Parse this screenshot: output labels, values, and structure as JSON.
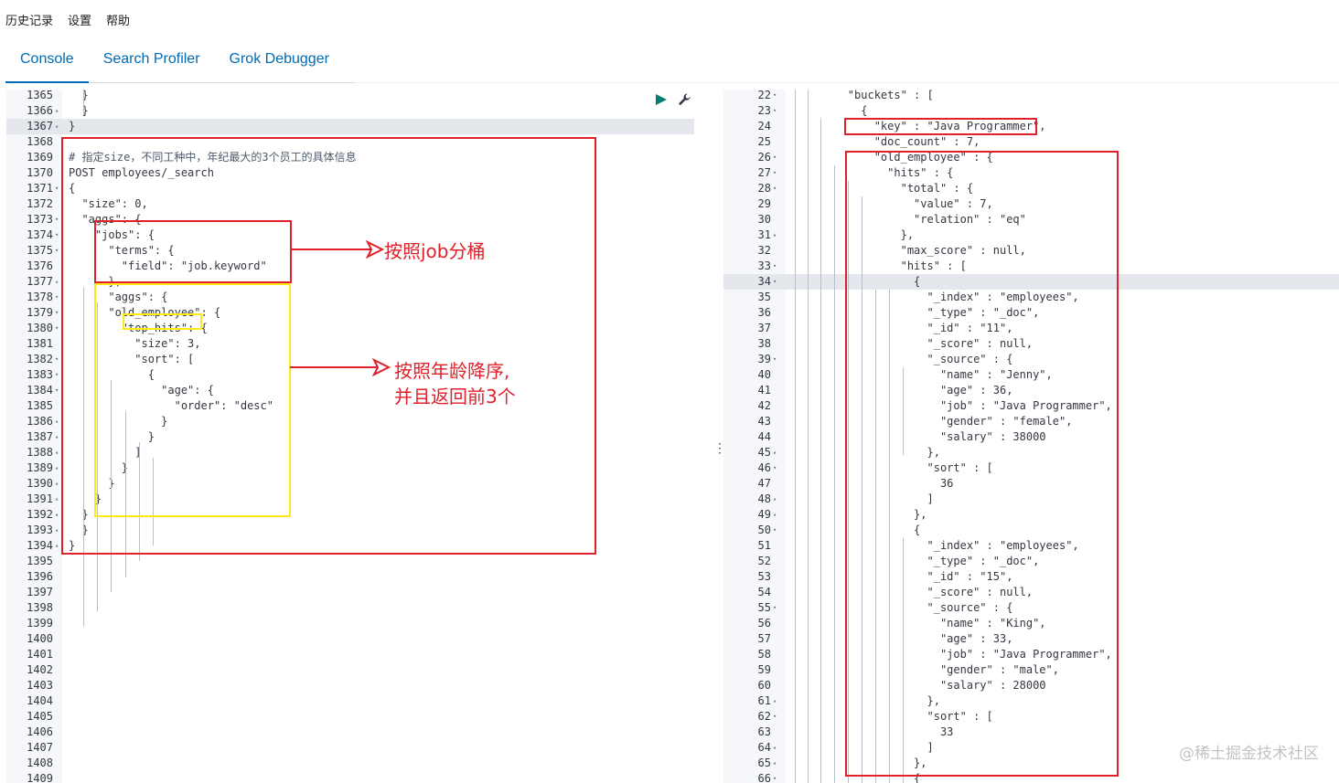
{
  "top_menu": [
    "历史记录",
    "设置",
    "帮助"
  ],
  "tabs": [
    "Console",
    "Search Profiler",
    "Grok Debugger"
  ],
  "active_tab": "Console",
  "annotations": {
    "terms_note": "按照job分桶",
    "top_hits_note_1": "按照年龄降序,",
    "top_hits_note_2": "并且返回前3个"
  },
  "watermark": "@稀土掘金技术社区",
  "icons": {
    "run": "play-icon",
    "settings": "wrench-icon",
    "splitter": "vertical-dots-icon"
  },
  "colors": {
    "accent": "#006bb4",
    "annotation_red": "#e0202a",
    "annotation_yellow": "#ffe81a"
  },
  "editor": {
    "lines": [
      {
        "no": "1365",
        "fold": "",
        "text": "  }"
      },
      {
        "no": "1366",
        "fold": "▴",
        "text": "  }"
      },
      {
        "no": "1367",
        "fold": "▴",
        "text": "}"
      },
      {
        "no": "1368",
        "fold": "",
        "text": ""
      },
      {
        "no": "1369",
        "fold": "",
        "text": "# 指定size，不同工种中，年纪最大的3个员工的具体信息"
      },
      {
        "no": "1370",
        "fold": "",
        "text": "POST employees/_search"
      },
      {
        "no": "1371",
        "fold": "▾",
        "text": "{"
      },
      {
        "no": "1372",
        "fold": "",
        "text": "  \"size\": 0,"
      },
      {
        "no": "1373",
        "fold": "▾",
        "text": "  \"aggs\": {"
      },
      {
        "no": "1374",
        "fold": "▾",
        "text": "    \"jobs\": {"
      },
      {
        "no": "1375",
        "fold": "▾",
        "text": "      \"terms\": {"
      },
      {
        "no": "1376",
        "fold": "",
        "text": "        \"field\": \"job.keyword\""
      },
      {
        "no": "1377",
        "fold": "▴",
        "text": "      },"
      },
      {
        "no": "1378",
        "fold": "▾",
        "text": "      \"aggs\": {"
      },
      {
        "no": "1379",
        "fold": "▾",
        "text": "      \"old_employee\": {"
      },
      {
        "no": "1380",
        "fold": "▾",
        "text": "        \"top_hits\": {"
      },
      {
        "no": "1381",
        "fold": "",
        "text": "          \"size\": 3,"
      },
      {
        "no": "1382",
        "fold": "▾",
        "text": "          \"sort\": ["
      },
      {
        "no": "1383",
        "fold": "▾",
        "text": "            {"
      },
      {
        "no": "1384",
        "fold": "▾",
        "text": "              \"age\": {"
      },
      {
        "no": "1385",
        "fold": "",
        "text": "                \"order\": \"desc\""
      },
      {
        "no": "1386",
        "fold": "▴",
        "text": "              }"
      },
      {
        "no": "1387",
        "fold": "▴",
        "text": "            }"
      },
      {
        "no": "1388",
        "fold": "▴",
        "text": "          ]"
      },
      {
        "no": "1389",
        "fold": "▴",
        "text": "        }"
      },
      {
        "no": "1390",
        "fold": "▴",
        "text": "      }"
      },
      {
        "no": "1391",
        "fold": "▴",
        "text": "    }"
      },
      {
        "no": "1392",
        "fold": "▴",
        "text": "  }"
      },
      {
        "no": "1393",
        "fold": "▴",
        "text": "  }"
      },
      {
        "no": "1394",
        "fold": "▴",
        "text": "}"
      },
      {
        "no": "1395",
        "fold": "",
        "text": ""
      },
      {
        "no": "1396",
        "fold": "",
        "text": ""
      },
      {
        "no": "1397",
        "fold": "",
        "text": ""
      },
      {
        "no": "1398",
        "fold": "",
        "text": ""
      },
      {
        "no": "1399",
        "fold": "",
        "text": ""
      },
      {
        "no": "1400",
        "fold": "",
        "text": ""
      },
      {
        "no": "1401",
        "fold": "",
        "text": ""
      },
      {
        "no": "1402",
        "fold": "",
        "text": ""
      },
      {
        "no": "1403",
        "fold": "",
        "text": ""
      },
      {
        "no": "1404",
        "fold": "",
        "text": ""
      },
      {
        "no": "1405",
        "fold": "",
        "text": ""
      },
      {
        "no": "1406",
        "fold": "",
        "text": ""
      },
      {
        "no": "1407",
        "fold": "",
        "text": ""
      },
      {
        "no": "1408",
        "fold": "",
        "text": ""
      },
      {
        "no": "1409",
        "fold": "",
        "text": ""
      }
    ]
  },
  "output": {
    "lines": [
      {
        "no": "22",
        "fold": "▾",
        "text": "        \"buckets\" : ["
      },
      {
        "no": "23",
        "fold": "▾",
        "text": "          {"
      },
      {
        "no": "24",
        "fold": "",
        "text": "            \"key\" : \"Java Programmer\","
      },
      {
        "no": "25",
        "fold": "",
        "text": "            \"doc_count\" : 7,"
      },
      {
        "no": "26",
        "fold": "▾",
        "text": "            \"old_employee\" : {"
      },
      {
        "no": "27",
        "fold": "▾",
        "text": "              \"hits\" : {"
      },
      {
        "no": "28",
        "fold": "▾",
        "text": "                \"total\" : {"
      },
      {
        "no": "29",
        "fold": "",
        "text": "                  \"value\" : 7,"
      },
      {
        "no": "30",
        "fold": "",
        "text": "                  \"relation\" : \"eq\""
      },
      {
        "no": "31",
        "fold": "▴",
        "text": "                },"
      },
      {
        "no": "32",
        "fold": "",
        "text": "                \"max_score\" : null,"
      },
      {
        "no": "33",
        "fold": "▾",
        "text": "                \"hits\" : ["
      },
      {
        "no": "34",
        "fold": "▾",
        "text": "                  {"
      },
      {
        "no": "35",
        "fold": "",
        "text": "                    \"_index\" : \"employees\","
      },
      {
        "no": "36",
        "fold": "",
        "text": "                    \"_type\" : \"_doc\","
      },
      {
        "no": "37",
        "fold": "",
        "text": "                    \"_id\" : \"11\","
      },
      {
        "no": "38",
        "fold": "",
        "text": "                    \"_score\" : null,"
      },
      {
        "no": "39",
        "fold": "▾",
        "text": "                    \"_source\" : {"
      },
      {
        "no": "40",
        "fold": "",
        "text": "                      \"name\" : \"Jenny\","
      },
      {
        "no": "41",
        "fold": "",
        "text": "                      \"age\" : 36,"
      },
      {
        "no": "42",
        "fold": "",
        "text": "                      \"job\" : \"Java Programmer\","
      },
      {
        "no": "43",
        "fold": "",
        "text": "                      \"gender\" : \"female\","
      },
      {
        "no": "44",
        "fold": "",
        "text": "                      \"salary\" : 38000"
      },
      {
        "no": "45",
        "fold": "▴",
        "text": "                    },"
      },
      {
        "no": "46",
        "fold": "▾",
        "text": "                    \"sort\" : ["
      },
      {
        "no": "47",
        "fold": "",
        "text": "                      36"
      },
      {
        "no": "48",
        "fold": "▴",
        "text": "                    ]"
      },
      {
        "no": "49",
        "fold": "▴",
        "text": "                  },"
      },
      {
        "no": "50",
        "fold": "▾",
        "text": "                  {"
      },
      {
        "no": "51",
        "fold": "",
        "text": "                    \"_index\" : \"employees\","
      },
      {
        "no": "52",
        "fold": "",
        "text": "                    \"_type\" : \"_doc\","
      },
      {
        "no": "53",
        "fold": "",
        "text": "                    \"_id\" : \"15\","
      },
      {
        "no": "54",
        "fold": "",
        "text": "                    \"_score\" : null,"
      },
      {
        "no": "55",
        "fold": "▾",
        "text": "                    \"_source\" : {"
      },
      {
        "no": "56",
        "fold": "",
        "text": "                      \"name\" : \"King\","
      },
      {
        "no": "57",
        "fold": "",
        "text": "                      \"age\" : 33,"
      },
      {
        "no": "58",
        "fold": "",
        "text": "                      \"job\" : \"Java Programmer\","
      },
      {
        "no": "59",
        "fold": "",
        "text": "                      \"gender\" : \"male\","
      },
      {
        "no": "60",
        "fold": "",
        "text": "                      \"salary\" : 28000"
      },
      {
        "no": "61",
        "fold": "▴",
        "text": "                    },"
      },
      {
        "no": "62",
        "fold": "▾",
        "text": "                    \"sort\" : ["
      },
      {
        "no": "63",
        "fold": "",
        "text": "                      33"
      },
      {
        "no": "64",
        "fold": "▴",
        "text": "                    ]"
      },
      {
        "no": "65",
        "fold": "▴",
        "text": "                  },"
      },
      {
        "no": "66",
        "fold": "▾",
        "text": "                  {"
      }
    ]
  }
}
